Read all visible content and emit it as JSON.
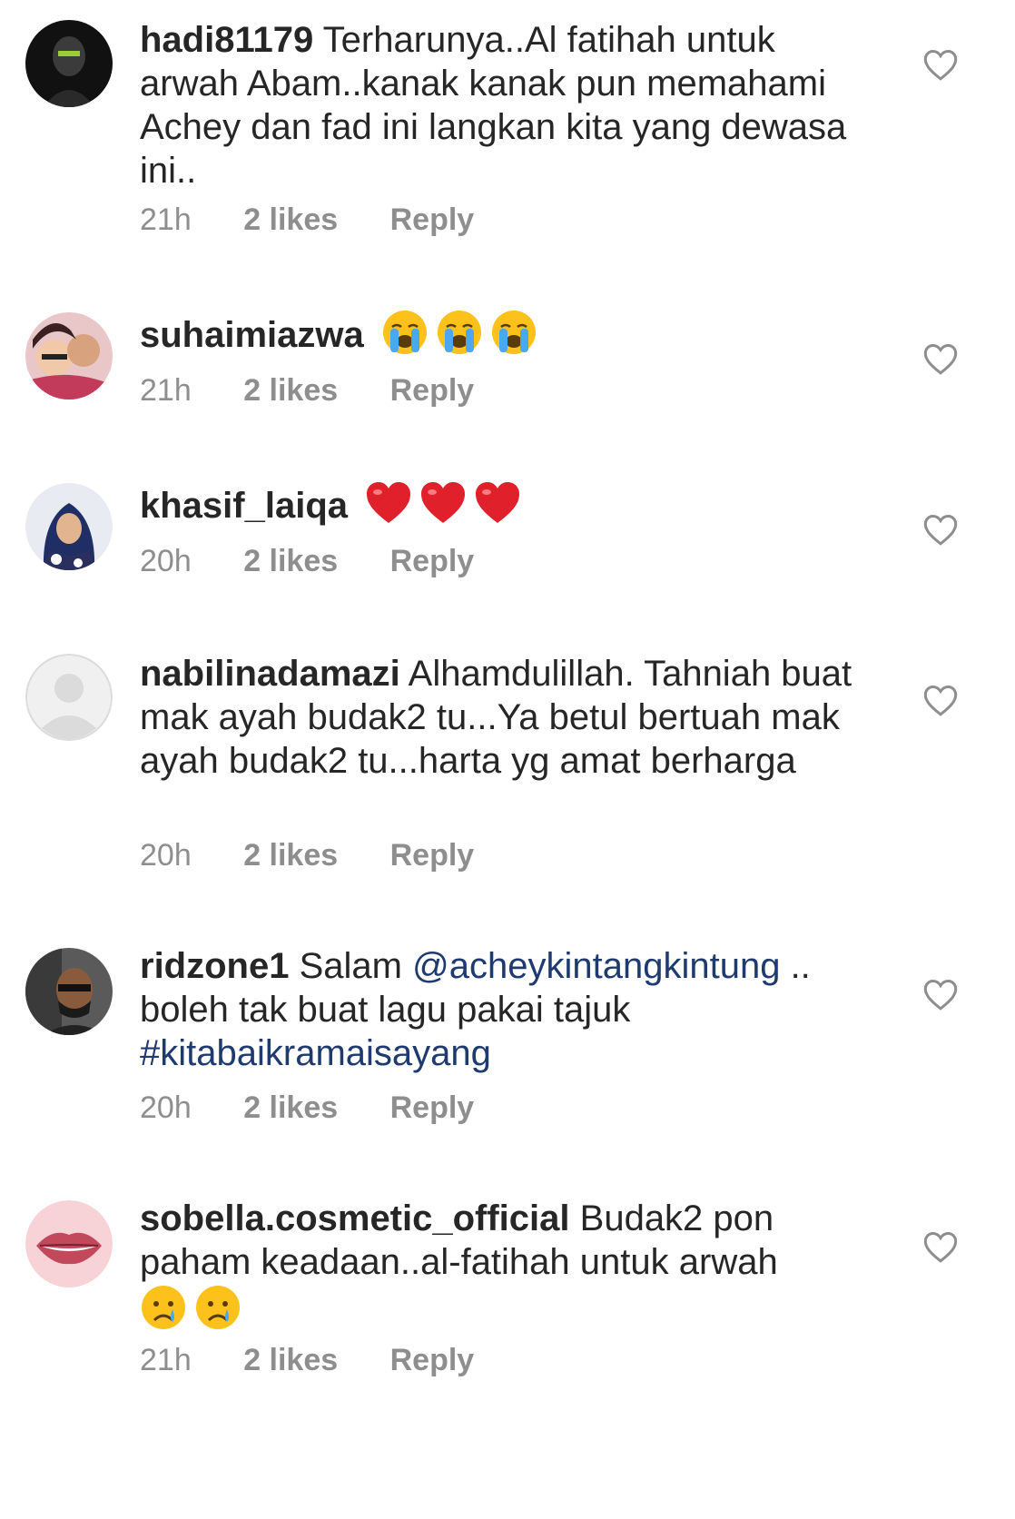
{
  "accent_link_color": "#1e3a6e",
  "meta_color": "#8e8e8e",
  "comments": [
    {
      "username": "hadi81179",
      "text": "Terharunya..Al fatihah untuk arwah Abam..kanak kanak pun memahami Achey dan fad ini langkan kita yang dewasa ini..",
      "time": "21h",
      "likes": "2 likes",
      "reply": "Reply"
    },
    {
      "username": "suhaimiazwa",
      "text": "",
      "emojis": [
        "loudly-crying-face",
        "loudly-crying-face",
        "loudly-crying-face"
      ],
      "time": "21h",
      "likes": "2 likes",
      "reply": "Reply"
    },
    {
      "username": "khasif_laiqa",
      "text": "",
      "emojis": [
        "red-heart",
        "red-heart",
        "red-heart"
      ],
      "time": "20h",
      "likes": "2 likes",
      "reply": "Reply"
    },
    {
      "username": "nabilinadamazi",
      "text": "Alhamdulillah. Tahniah buat mak ayah budak2 tu...Ya betul bertuah mak ayah budak2 tu...harta yg amat berharga",
      "time": "20h",
      "likes": "2 likes",
      "reply": "Reply"
    },
    {
      "username": "ridzone1",
      "text_before": "Salam",
      "mention": "@acheykintangkintung",
      "text_middle": "..\nboleh tak buat lagu pakai tajuk",
      "hashtag": "#kitabaikramaisayang",
      "time": "20h",
      "likes": "2 likes",
      "reply": "Reply"
    },
    {
      "username": "sobella.cosmetic_official",
      "text": "Budak2 pon paham keadaan..al-fatihah untuk arwah",
      "emojis": [
        "crying-face",
        "crying-face"
      ],
      "time": "21h",
      "likes": "2 likes",
      "reply": "Reply"
    }
  ]
}
